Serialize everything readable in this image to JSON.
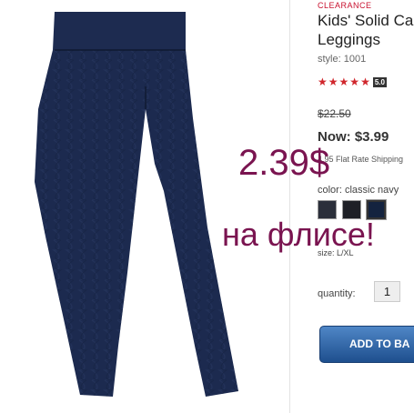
{
  "product": {
    "clearance_label": "CLEARANCE",
    "title": "Kids' Solid Ca Leggings",
    "style_text": "style: 1001",
    "rating_value": "5.0",
    "star_count": 5,
    "original_price": "$22.50",
    "now_price": "Now: $3.99",
    "shipping_text": "4.95 Flat Rate Shipping",
    "color_text": "color: classic navy",
    "size_text": "size: L/XL",
    "quantity_label": "quantity:",
    "quantity_value": "1",
    "add_button_label": "ADD TO BA"
  },
  "swatches": [
    {
      "color": "#2b2f3a"
    },
    {
      "color": "#1e2026"
    },
    {
      "color": "#14233f",
      "selected": true
    }
  ],
  "overlay": {
    "price_note": "2.39$",
    "fleece_note": "на флисе!"
  },
  "colors": {
    "clearance_red": "#c8102e",
    "star_red": "#d0262c",
    "overlay_text": "#7a1450",
    "button_blue": "#2a5d9e",
    "leggings_navy": "#1c2a4f"
  }
}
